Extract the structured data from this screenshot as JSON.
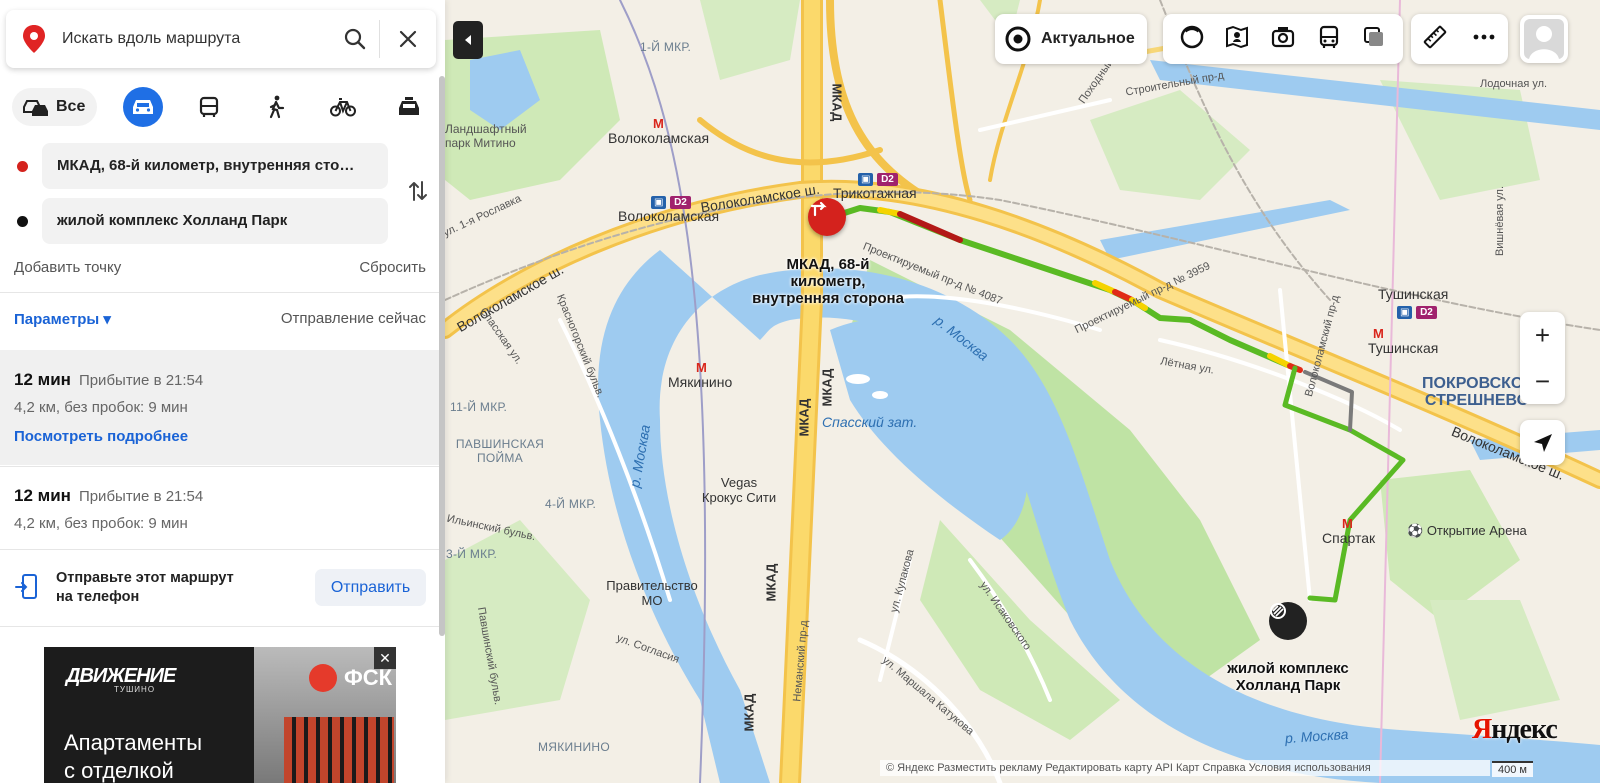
{
  "search": {
    "placeholder": "Искать вдоль маршрута"
  },
  "modes": {
    "all_label": "Все"
  },
  "route": {
    "from": "МКАД, 68-й километр, внутренняя сто…",
    "to": "жилой комплекс Холланд Парк",
    "add_point": "Добавить точку",
    "reset": "Сбросить",
    "params": "Параметры ▾",
    "departure": "Отправление сейчас"
  },
  "routes": [
    {
      "time": "12 мин",
      "arrival": "Прибытие в 21:54",
      "meta": "4,2 км, без пробок: 9 мин",
      "more": "Посмотреть подробнее"
    },
    {
      "time": "12 мин",
      "arrival": "Прибытие в 21:54",
      "meta": "4,2 км, без пробок: 9 мин"
    }
  ],
  "send": {
    "text_line1": "Отправьте этот маршрут",
    "text_line2": "на телефон",
    "button": "Отправить"
  },
  "ad": {
    "logo": "ДВИЖЕНИЕ",
    "logo_sub": "ТУШИНО",
    "brand": "ФСК",
    "title_line1": "Апартаменты",
    "title_line2": "с отделкой",
    "close": "✕"
  },
  "map_controls": {
    "actual": "Актуальное",
    "zoom_in": "+",
    "zoom_out": "−",
    "logo_ya": "Я",
    "logo_rest": "ндекс",
    "copyright": "© Яндекс  Разместить рекламу  Редактировать карту  API Карт  Справка  Условия использования",
    "scale": "400 м"
  },
  "map_labels": {
    "mkr1": "1-Й МКР.",
    "volokolamskaya_1": "Волоколамская",
    "volokolamskaya_2": "Волоколамская",
    "landscape_park": "Ландшафтный парк Митино",
    "trikotazhnaya": "Трикотажная",
    "volokolamskoe_sh_1": "Волоколамское ш.",
    "volokolamskoe_sh_2": "Волоколамское ш.",
    "volokolamskoe_sh_3": "Волоколамское ш.",
    "mkad_1": "МКАД",
    "mkad_2": "МКАД",
    "mkad_3": "МКАД",
    "mkad_4": "МКАД",
    "mkad_5": "МКАД",
    "start_line1": "МКАД, 68-й",
    "start_line2": "километр,",
    "start_line3": "внутренняя сторона",
    "proektiruemy_4087": "Проектируемый пр-д № 4087",
    "proektiruemy_3959": "Проектируемый пр-д № 3959",
    "moskva_river_1": "р. Москва",
    "moskva_river_2": "р. Москва",
    "moskva_river_3": "р. Москва",
    "spassky_zaton": "Спасский зат.",
    "myakinino": "Мякинино",
    "krasnogorsky": "Красногорский бульв.",
    "spasskaya": "Спасская ул.",
    "mkr11": "11-Й МКР.",
    "pavshinskaya": "ПАВШИНСКАЯ ПОЙМА",
    "mkr4": "4-Й МКР.",
    "mkr3": "3-Й МКР.",
    "vegas": "Vegas Крокус Сити",
    "pravitelstvo": "Правительство МО",
    "soglasiya": "ул. Согласия",
    "tushinskaya": "Тушинская",
    "tushinskaya_2": "Тушинская",
    "pokrovskoe": "ПОКРОВСКОЕ-СТРЕШНЕВО",
    "letnyaya": "Лётная ул.",
    "volokolamsky_pr": "Волоколамский пр-д",
    "spartak": "Спартак",
    "otkrytie_arena": "Открытие Арена",
    "end_line1": "жилой комплекс",
    "end_line2": "Холланд Парк",
    "kulakova": "ул. Кулакова",
    "isakovskogo": "ул. Исаковского",
    "katukova": "ул. Маршала Катукова",
    "nemansky": "Неманский пр-д",
    "stroitelny": "Строительный пр-д",
    "lodochnaya": "Лодочная ул.",
    "vishnevaya": "Вишнёвая ул.",
    "roslavka": "ул. 1-я Рославка",
    "myakinino_bottom": "МЯКИНИНО",
    "pokhodny": "Походный пр-д",
    "pavshinsky_bulv": "Павшинский бульв.",
    "zhulebinsky": "Ильинский бульв.",
    "d2": "D2"
  }
}
